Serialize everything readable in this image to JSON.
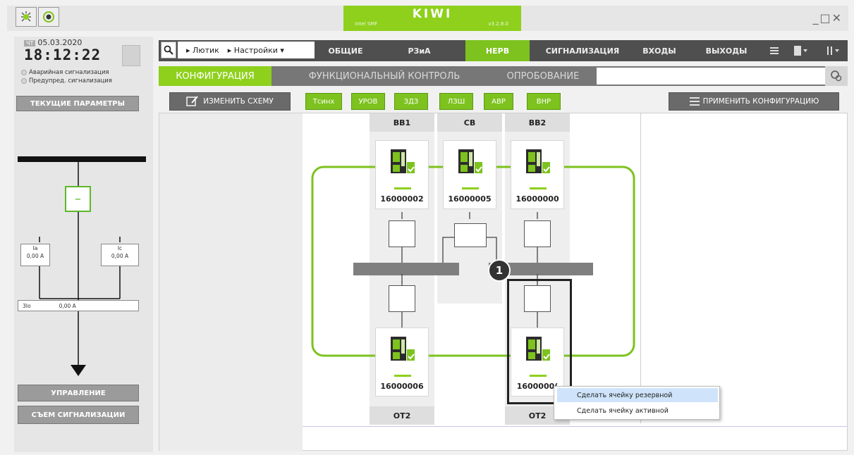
{
  "app": {
    "title": "KIWI",
    "subtitle": "Intel SMF",
    "version": "v3.2.8.0",
    "window_controls": "_□✕",
    "icons": [
      "kiwi-logo-icon",
      "record-icon"
    ]
  },
  "left": {
    "day": "ЧТ",
    "date": "05.03.2020",
    "time": "18:12:22",
    "alarm_emergency": "Аварийная сигнализация",
    "alarm_warning": "Предупред. сигнализация",
    "current_params": "ТЕКУЩИЕ ПАРАМЕТРЫ",
    "ia_label": "Ia",
    "ia_value": "0,00 A",
    "ic_label": "Ic",
    "ic_value": "0,00 A",
    "i0_label": "3Io",
    "i0_value": "0,00 A",
    "breaker_symbol": "–",
    "control": "УПРАВЛЕНИЕ",
    "reset_alarm": "СЪЕМ СИГНАЛИЗАЦИИ"
  },
  "toolbar": {
    "crumb1": "Лютик",
    "crumb2": "Настройки",
    "tabs": [
      "ОБЩИЕ",
      "РЗиА",
      "НЕРВ",
      "СИГНАЛИЗАЦИЯ",
      "ВХОДЫ",
      "ВЫХОДЫ"
    ],
    "active_tab": "НЕРВ"
  },
  "subtabs": {
    "items": [
      "КОНФИГУРАЦИЯ",
      "ФУНКЦИОНАЛЬНЫЙ КОНТРОЛЬ",
      "ОПРОБОВАНИЕ"
    ],
    "active": "КОНФИГУРАЦИЯ"
  },
  "actions": {
    "edit_scheme": "ИЗМЕНИТЬ СХЕМУ",
    "functions": [
      "Тсинх",
      "УРОВ",
      "ЗДЗ",
      "ЛЗШ",
      "АВР",
      "ВНР"
    ],
    "apply": "ПРИМЕНИТЬ КОНФИГУРАЦИЮ"
  },
  "scheme": {
    "columns": [
      "ВВ1",
      "СВ",
      "ВВ2"
    ],
    "top_devices": [
      "16000002",
      "16000005",
      "16000000"
    ],
    "bottom_devices": [
      "16000006",
      "1600000("
    ],
    "bottom_labels": [
      "ОТ2",
      "ОТ2"
    ],
    "badge": "1"
  },
  "context_menu": {
    "items": [
      "Сделать ячейку резервной",
      "Сделать ячейку активной"
    ]
  },
  "colors": {
    "accent": "#8ed01c",
    "toolbar": "#4f4f4f",
    "bus": "#7f7f7f"
  }
}
